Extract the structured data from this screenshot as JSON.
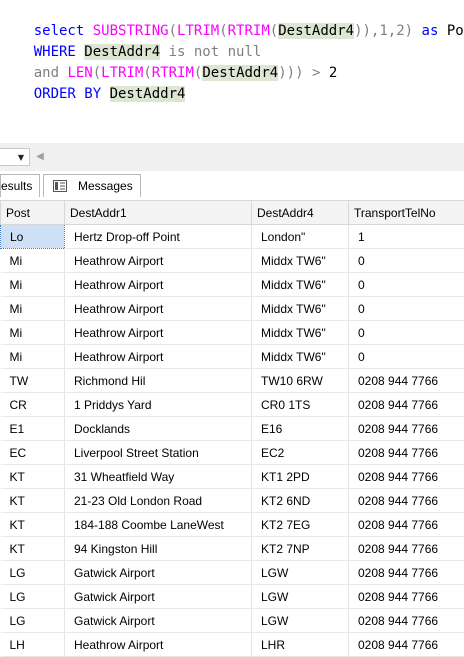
{
  "editor": {
    "line1": {
      "select": "select ",
      "substring": "SUBSTRING",
      "p1": "(",
      "ltrim": "LTRIM",
      "p2": "(",
      "rtrim": "RTRIM",
      "p3": "(",
      "field": "DestAddr4",
      "p4": ")),1,2)",
      "as": " as ",
      "alias": "Post"
    },
    "line2": {
      "where": "WHERE ",
      "field": "DestAddr4",
      "rest": " is not null"
    },
    "line3": {
      "and": "and ",
      "len": "LEN",
      "p1": "(",
      "ltrim": "LTRIM",
      "p2": "(",
      "rtrim": "RTRIM",
      "p3": "(",
      "field": "DestAddr4",
      "p4": ")))",
      "gt": " > ",
      "num": "2"
    },
    "line4": {
      "order": "ORDER BY ",
      "field": "DestAddr4"
    }
  },
  "results_pane": {
    "dropdown_icon": "chevron-down-icon",
    "scroll_left_icon": "chevron-left-icon",
    "tabs": [
      {
        "label": "esults"
      },
      {
        "label": "Messages"
      }
    ],
    "columns": [
      "Post",
      "DestAddr1",
      "DestAddr4",
      "TransportTelNo"
    ],
    "rows": [
      [
        "Lo",
        "Hertz Drop-off Point",
        "London\"",
        "1"
      ],
      [
        "Mi",
        "Heathrow Airport",
        "Middx TW6\"",
        "0"
      ],
      [
        "Mi",
        "Heathrow Airport",
        "Middx TW6\"",
        "0"
      ],
      [
        "Mi",
        "Heathrow Airport",
        "Middx TW6\"",
        "0"
      ],
      [
        "Mi",
        "Heathrow Airport",
        "Middx TW6\"",
        "0"
      ],
      [
        "Mi",
        "Heathrow Airport",
        "Middx TW6\"",
        "0"
      ],
      [
        "TW",
        "Richmond Hil",
        "TW10 6RW",
        "0208 944 7766"
      ],
      [
        "CR",
        "1 Priddys Yard",
        "CR0 1TS",
        "0208 944 7766"
      ],
      [
        "E1",
        "Docklands",
        "E16",
        "0208 944 7766"
      ],
      [
        "EC",
        "Liverpool Street Station",
        "EC2",
        "0208 944 7766"
      ],
      [
        "KT",
        "31 Wheatfield Way",
        "KT1 2PD",
        "0208 944 7766"
      ],
      [
        "KT",
        "21-23 Old London Road",
        "KT2 6ND",
        "0208 944 7766"
      ],
      [
        "KT",
        "184-188 Coombe LaneWest",
        "KT2 7EG",
        "0208 944 7766"
      ],
      [
        "KT",
        "94 Kingston Hill",
        "KT2 7NP",
        "0208 944 7766"
      ],
      [
        "LG",
        "Gatwick Airport",
        "LGW",
        "0208 944 7766"
      ],
      [
        "LG",
        "Gatwick Airport",
        "LGW",
        "0208 944 7766"
      ],
      [
        "LG",
        "Gatwick Airport",
        "LGW",
        "0208 944 7766"
      ],
      [
        "LH",
        "Heathrow Airport",
        "LHR",
        "0208 944 7766"
      ]
    ]
  }
}
